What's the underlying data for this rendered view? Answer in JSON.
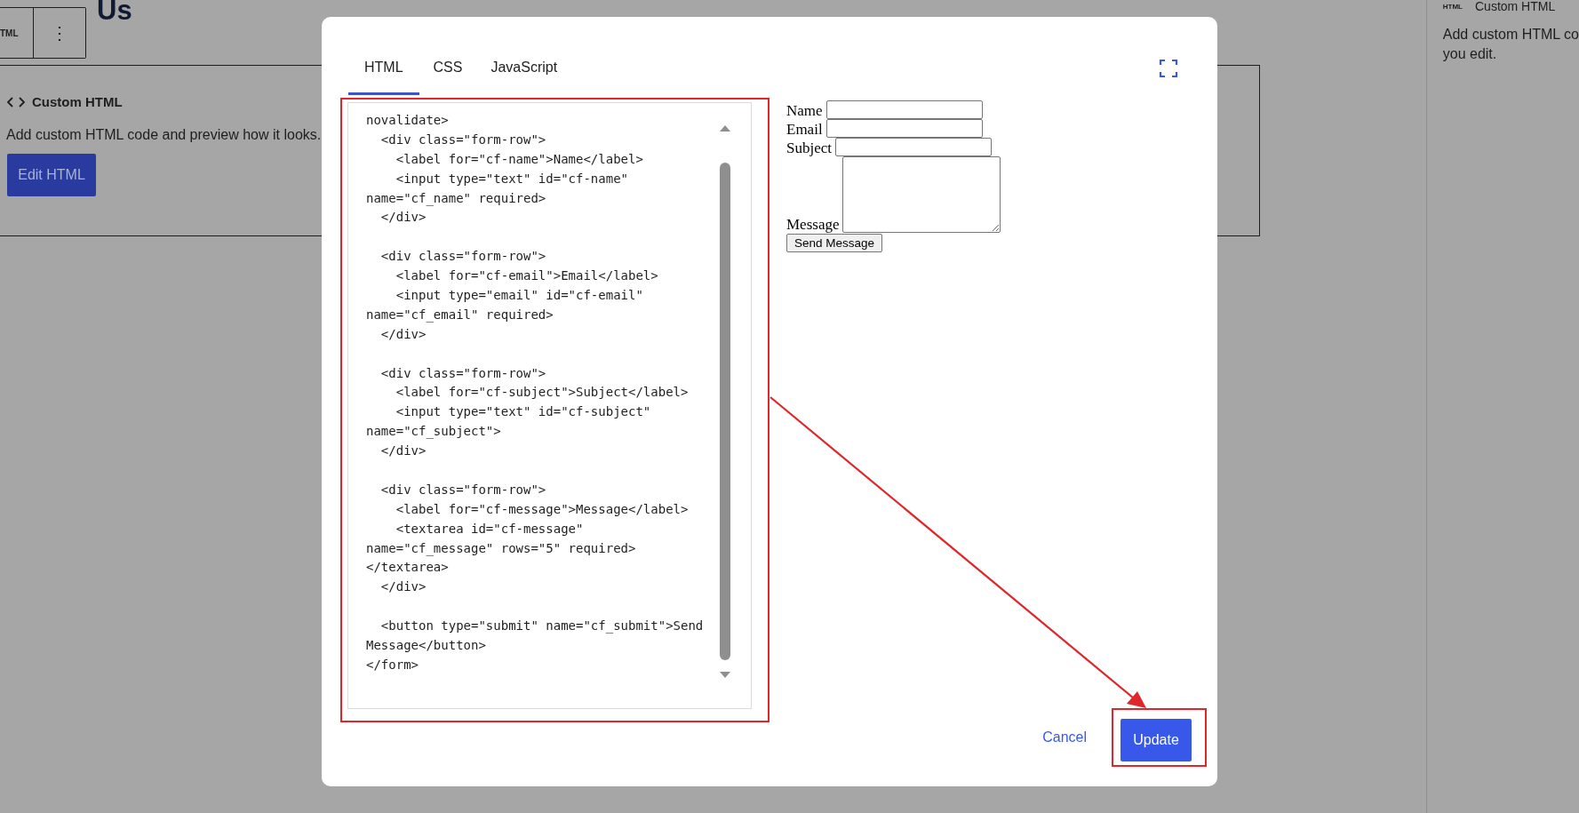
{
  "page": {
    "title": "Us",
    "toolbar": {
      "block_label": "TML",
      "more": "⋮"
    },
    "block": {
      "title": "Custom HTML",
      "description": "Add custom HTML code and preview how it looks.",
      "button": "Edit HTML"
    }
  },
  "sidebar": {
    "badge": "HTML",
    "title": "Custom HTML",
    "description_lines": [
      "Add custom HTML co",
      "you edit."
    ]
  },
  "dialog": {
    "tabs": [
      {
        "label": "HTML",
        "selected": true
      },
      {
        "label": "CSS",
        "selected": false
      },
      {
        "label": "JavaScript",
        "selected": false
      }
    ],
    "code_blocks": [
      [
        "novalidate>",
        "  <div class=\"form-row\">",
        "    <label for=\"cf-name\">Name</label>",
        "    <input type=\"text\" id=\"cf-name\"",
        "name=\"cf_name\" required>",
        "  </div>"
      ],
      [
        "  <div class=\"form-row\">",
        "    <label for=\"cf-email\">Email</label>",
        "    <input type=\"email\" id=\"cf-email\"",
        "name=\"cf_email\" required>",
        "  </div>"
      ],
      [
        "  <div class=\"form-row\">",
        "    <label for=\"cf-subject\">Subject</label>",
        "    <input type=\"text\" id=\"cf-subject\"",
        "name=\"cf_subject\">",
        "  </div>"
      ],
      [
        "  <div class=\"form-row\">",
        "    <label for=\"cf-message\">Message</label>",
        "    <textarea id=\"cf-message\"",
        "name=\"cf_message\" rows=\"5\" required>",
        "</textarea>",
        "  </div>"
      ],
      [
        "  <button type=\"submit\" name=\"cf_submit\">Send",
        "Message</button>",
        "</form>"
      ]
    ],
    "preview": {
      "fields": [
        {
          "label": "Name",
          "kind": "input"
        },
        {
          "label": "Email",
          "kind": "input"
        },
        {
          "label": "Subject",
          "kind": "input"
        },
        {
          "label": "Message",
          "kind": "textarea"
        }
      ],
      "button": "Send Message"
    },
    "actions": {
      "cancel": "Cancel",
      "update": "Update"
    }
  }
}
